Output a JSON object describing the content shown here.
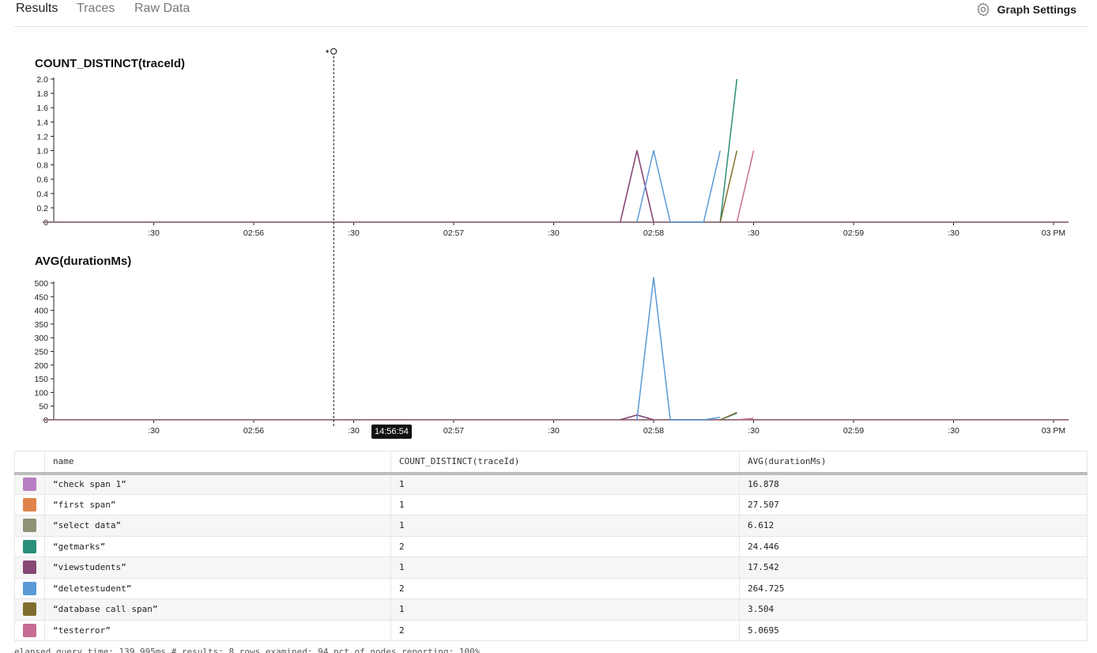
{
  "tabs": [
    {
      "label": "Results",
      "active": true
    },
    {
      "label": "Traces",
      "active": false
    },
    {
      "label": "Raw Data",
      "active": false
    }
  ],
  "graph_settings": {
    "label": "Graph Settings",
    "icon": "gear-icon"
  },
  "cursor_time": "14:56:54",
  "x_ticks": [
    ":30",
    "02:56",
    ":30",
    "02:57",
    ":30",
    "02:58",
    ":30",
    "02:59",
    ":30",
    "03 PM"
  ],
  "series": [
    {
      "name": "“check span 1”",
      "color": "#b77fc1"
    },
    {
      "name": "“first span”",
      "color": "#e0834b"
    },
    {
      "name": "“select data”",
      "color": "#8e9375"
    },
    {
      "name": "“getmarks”",
      "color": "#2a8f7a"
    },
    {
      "name": "“viewstudents”",
      "color": "#874873"
    },
    {
      "name": "“deletestudent”",
      "color": "#5b99d6"
    },
    {
      "name": "“database call span”",
      "color": "#7f6d2d"
    },
    {
      "name": "“testerror”",
      "color": "#c76c93"
    }
  ],
  "chart_data": [
    {
      "type": "line",
      "title": "COUNT_DISTINCT(traceId)",
      "x_unit": "time",
      "ylim": [
        0,
        2.0
      ],
      "y_ticks": [
        "0",
        "0.2",
        "0.4",
        "0.6",
        "0.8",
        "1.0",
        "1.2",
        "1.4",
        "1.6",
        "1.8",
        "2.0"
      ],
      "series": [
        {
          "name": "“check span 1”",
          "points": [
            [
              "14:58:20",
              0
            ],
            [
              "14:58:25",
              1
            ],
            [
              "14:58:30",
              0
            ]
          ]
        },
        {
          "name": "“viewstudents”",
          "points": [
            [
              "14:58:20",
              0
            ],
            [
              "14:58:25",
              1
            ],
            [
              "14:58:30",
              0
            ]
          ]
        },
        {
          "name": "“deletestudent”",
          "points": [
            [
              "14:58:25",
              0
            ],
            [
              "14:58:30",
              1
            ],
            [
              "14:58:35",
              0
            ],
            [
              "14:58:45",
              0
            ],
            [
              "14:58:50",
              1
            ]
          ]
        },
        {
          "name": "“getmarks”",
          "points": [
            [
              "14:58:50",
              0
            ],
            [
              "14:58:55",
              2
            ]
          ]
        },
        {
          "name": "“database call span”",
          "points": [
            [
              "14:58:50",
              0
            ],
            [
              "14:58:55",
              1
            ]
          ]
        },
        {
          "name": "“testerror”",
          "points": [
            [
              "14:58:55",
              0
            ],
            [
              "14:59:00",
              1
            ]
          ]
        }
      ]
    },
    {
      "type": "line",
      "title": "AVG(durationMs)",
      "x_unit": "time",
      "ylim": [
        0,
        520
      ],
      "y_ticks": [
        "0",
        "50",
        "100",
        "150",
        "200",
        "250",
        "300",
        "350",
        "400",
        "450",
        "500"
      ],
      "series": [
        {
          "name": "“check span 1”",
          "points": [
            [
              "14:58:20",
              0
            ],
            [
              "14:58:25",
              17
            ],
            [
              "14:58:30",
              0
            ]
          ]
        },
        {
          "name": "“viewstudents”",
          "points": [
            [
              "14:58:20",
              0
            ],
            [
              "14:58:25",
              18
            ],
            [
              "14:58:30",
              0
            ]
          ]
        },
        {
          "name": "“deletestudent”",
          "points": [
            [
              "14:58:25",
              0
            ],
            [
              "14:58:30",
              520
            ],
            [
              "14:58:35",
              0
            ],
            [
              "14:58:45",
              0
            ],
            [
              "14:58:50",
              9
            ]
          ]
        },
        {
          "name": "“getmarks”",
          "points": [
            [
              "14:58:50",
              0
            ],
            [
              "14:58:55",
              24
            ]
          ]
        },
        {
          "name": "“database call span”",
          "points": [
            [
              "14:58:50",
              0
            ],
            [
              "14:58:55",
              27
            ]
          ]
        },
        {
          "name": "“testerror”",
          "points": [
            [
              "14:58:55",
              0
            ],
            [
              "14:59:00",
              5
            ]
          ]
        }
      ]
    }
  ],
  "table": {
    "columns": [
      "name",
      "COUNT_DISTINCT(traceId)",
      "AVG(durationMs)"
    ],
    "rows": [
      {
        "name": "“check span 1”",
        "count": "1",
        "avg": "16.878",
        "color": "#b77fc1"
      },
      {
        "name": "“first span”",
        "count": "1",
        "avg": "27.507",
        "color": "#e0834b"
      },
      {
        "name": "“select data”",
        "count": "1",
        "avg": "6.612",
        "color": "#8e9375"
      },
      {
        "name": "“getmarks”",
        "count": "2",
        "avg": "24.446",
        "color": "#2a8f7a"
      },
      {
        "name": "“viewstudents”",
        "count": "1",
        "avg": "17.542",
        "color": "#874873"
      },
      {
        "name": "“deletestudent”",
        "count": "2",
        "avg": "264.725",
        "color": "#5b99d6"
      },
      {
        "name": "“database call span”",
        "count": "1",
        "avg": "3.504",
        "color": "#7f6d2d"
      },
      {
        "name": "“testerror”",
        "count": "2",
        "avg": "5.0695",
        "color": "#c76c93"
      }
    ]
  },
  "footer": "elapsed query time: 139.995ms   # results: 8   rows examined: 94   pct of nodes reporting: 100%"
}
